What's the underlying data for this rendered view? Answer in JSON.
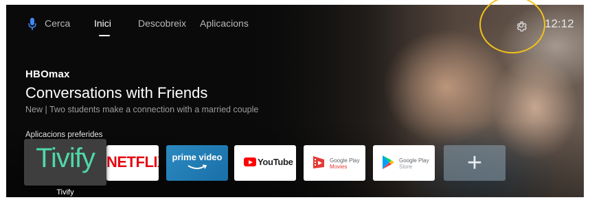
{
  "nav": {
    "search_label": "Cerca",
    "tabs": [
      {
        "label": "Inici",
        "active": true
      },
      {
        "label": "Descobreix",
        "active": false
      },
      {
        "label": "Aplicacions",
        "active": false
      }
    ],
    "settings_icon": "gear-icon",
    "clock": "12:12"
  },
  "hero": {
    "brand": "HBOmax",
    "title": "Conversations with Friends",
    "subtitle": "New | Two students make a connection with a married couple"
  },
  "apps": {
    "section_label": "Aplicacions preferides",
    "focused_caption": "Tivify",
    "items": [
      {
        "label": "Tivify",
        "focused": true
      },
      {
        "label": "NETFLIX"
      },
      {
        "label": "prime video"
      },
      {
        "label": "YouTube"
      },
      {
        "line1": "Google Play",
        "line2": "Movies"
      },
      {
        "line1": "Google Play",
        "line2": "Store"
      },
      {
        "label": "+"
      }
    ]
  },
  "colors": {
    "highlight_ring": "#f2c21b",
    "tivify_green": "#4fd8a8",
    "netflix_red": "#e50914",
    "prime_blue": "#1a6fa8",
    "youtube_red": "#ff0000",
    "movies_red": "#e53935"
  }
}
